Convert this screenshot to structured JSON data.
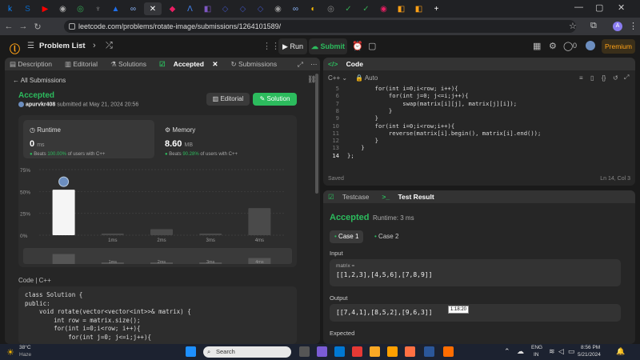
{
  "browser": {
    "tabs": [
      {
        "icon": "k",
        "color": "#0b84ff"
      },
      {
        "icon": "S",
        "color": "#0a66c2"
      },
      {
        "icon": "▶",
        "color": "#ff0000"
      },
      {
        "icon": "◉",
        "color": "#aaa"
      },
      {
        "icon": "◎",
        "color": "#34a853"
      },
      {
        "icon": "♆",
        "color": "#888"
      },
      {
        "icon": "▲",
        "color": "#1f6feb"
      },
      {
        "icon": "∞",
        "color": "#8ab4f8"
      },
      {
        "icon": "✕",
        "color": "#fff",
        "active": true
      },
      {
        "icon": "◆",
        "color": "#e91e63"
      },
      {
        "icon": "Λ",
        "color": "#4285f4"
      },
      {
        "icon": "◧",
        "color": "#7e57c2"
      },
      {
        "icon": "◇",
        "color": "#3f51b5"
      },
      {
        "icon": "◇",
        "color": "#3f51b5"
      },
      {
        "icon": "◇",
        "color": "#3f51b5"
      },
      {
        "icon": "◉",
        "color": "#999"
      },
      {
        "icon": "∞",
        "color": "#8ab4f8"
      },
      {
        "icon": "◐",
        "color": "#fbbc04"
      },
      {
        "icon": "◎",
        "color": "#888"
      },
      {
        "icon": "✓",
        "color": "#34a853"
      },
      {
        "icon": "✓",
        "color": "#34a853"
      },
      {
        "icon": "◉",
        "color": "#e91e63"
      },
      {
        "icon": "◧",
        "color": "#ffa116"
      },
      {
        "icon": "◧",
        "color": "#ffa116"
      }
    ],
    "new_tab": "+",
    "url": "leetcode.com/problems/rotate-image/submissions/1264101589/",
    "profile_initial": "A"
  },
  "header": {
    "problem_list": "Problem List",
    "run": "Run",
    "submit": "Submit",
    "coins": "0",
    "premium": "Premium"
  },
  "left": {
    "tabs": [
      "Description",
      "Editorial",
      "Solutions",
      "Accepted",
      "Submissions"
    ],
    "all_submissions": "All Submissions",
    "status": "Accepted",
    "user": "apurvkr408",
    "submitted": " submitted at May 21, 2024 20:56",
    "editorial_btn": "Editorial",
    "solution_btn": "Solution",
    "runtime": {
      "label": "Runtime",
      "value": "0",
      "unit": "ms",
      "beats": "Beats ",
      "pct": "100.00%",
      "suffix": " of users with C++"
    },
    "memory": {
      "label": "Memory",
      "value": "8.60",
      "unit": "MB",
      "beats": "Beats ",
      "pct": "90.28%",
      "suffix": " of users with C++"
    },
    "code_label": "Code  |  C++"
  },
  "chart_data": {
    "type": "bar",
    "categories": [
      "0ms",
      "1ms",
      "2ms",
      "3ms",
      "4ms"
    ],
    "tick_labels": [
      "",
      "1ms",
      "2ms",
      "3ms",
      "4ms"
    ],
    "values": [
      52,
      2,
      7,
      2,
      31
    ],
    "highlight": 0,
    "yticks": [
      "75%",
      "50%",
      "25%",
      "0%"
    ],
    "ylim": [
      0,
      75
    ],
    "mini_labels": [
      "1ms",
      "2ms",
      "3ms",
      "4ms"
    ]
  },
  "code": {
    "lang": "C++",
    "mode": "Auto",
    "title": "Code",
    "lines": [
      {
        "n": "5",
        "t": "        for(int i=0;i<row; i++){"
      },
      {
        "n": "6",
        "t": "            for(int j=0; j<=i;j++){"
      },
      {
        "n": "7",
        "t": "                swap(matrix[i][j], matrix[j][i]);"
      },
      {
        "n": "8",
        "t": "            }"
      },
      {
        "n": "9",
        "t": "        }"
      },
      {
        "n": "10",
        "t": "        for(int i=0;i<row;i++){"
      },
      {
        "n": "11",
        "t": "            reverse(matrix[i].begin(), matrix[i].end());"
      },
      {
        "n": "12",
        "t": "        }"
      },
      {
        "n": "13",
        "t": "    }"
      },
      {
        "n": "14",
        "t": "};"
      }
    ],
    "saved": "Saved",
    "position": "Ln 14, Col 3"
  },
  "snippet": [
    "class Solution {",
    "public:",
    "    void rotate(vector<vector<int>>& matrix) {",
    "        int row = matrix.size();",
    "        for(int i=0;i<row; i++){",
    "            for(int j=0; j<=i;j++){"
  ],
  "test": {
    "tabs": [
      "Testcase",
      "Test Result"
    ],
    "status": "Accepted",
    "runtime": "Runtime: 3 ms",
    "case1": "Case 1",
    "case2": "Case 2",
    "input_label": "Input",
    "input_name": "matrix =",
    "input_value": "[[1,2,3],[4,5,6],[7,8,9]]",
    "output_label": "Output",
    "output_value": "[[7,4,1],[8,5,2],[9,6,3]]",
    "expected_label": "Expected",
    "tooltip": "1:18:20"
  },
  "taskbar": {
    "temp": "38°C",
    "weather": "Haze",
    "search": "Search",
    "lang1": "ENG",
    "lang2": "IN",
    "time": "8:56 PM",
    "date": "5/21/2024"
  }
}
